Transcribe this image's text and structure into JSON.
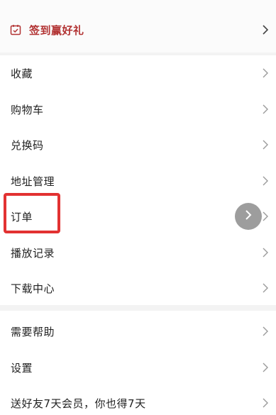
{
  "checkin": {
    "label": "签到赢好礼",
    "icon": "calendar-check-icon",
    "color": "#b23333"
  },
  "menu": {
    "items": [
      {
        "label": "收藏"
      },
      {
        "label": "购物车"
      },
      {
        "label": "兑换码"
      },
      {
        "label": "地址管理"
      },
      {
        "label": "订单"
      },
      {
        "label": "播放记录"
      },
      {
        "label": "下载中心"
      }
    ]
  },
  "support": {
    "items": [
      {
        "label": "需要帮助"
      },
      {
        "label": "设置"
      },
      {
        "label": "送好友7天会员，你也得7天"
      }
    ]
  },
  "highlight_color": "#e23232",
  "chevron_icon": "chevron-right-icon",
  "floating_button_icon": "chevron-right-icon"
}
